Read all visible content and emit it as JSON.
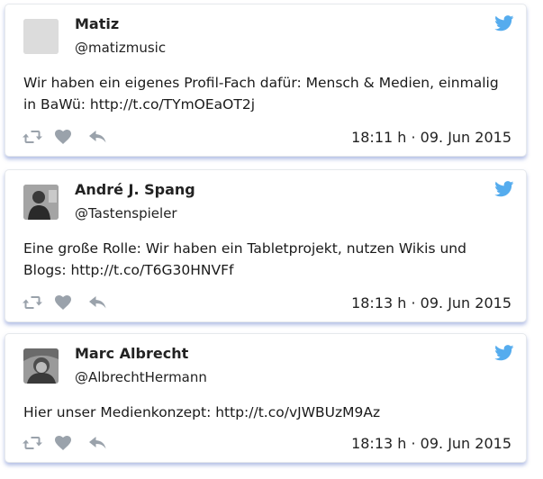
{
  "colors": {
    "twitter_blue": "#55acee",
    "icon_gray": "#9aa2ab",
    "text": "#1a1a1a"
  },
  "tweets": [
    {
      "name": "Matiz",
      "handle": "@matizmusic",
      "avatar": "placeholder-avatar",
      "text": "Wir haben ein eigenes Profil-Fach dafür: Mensch & Medien, einmalig in BaWü: http://t.co/TYmOEaOT2j",
      "timestamp": "18:11 h · 09. Jun 2015"
    },
    {
      "name": "André J. Spang",
      "handle": "@Tastenspieler",
      "avatar": "profile-photo-avatar",
      "text": "Eine große Rolle: Wir haben ein Tabletprojekt, nutzen Wikis und Blogs: http://t.co/T6G30HNVFf",
      "timestamp": "18:13 h · 09. Jun 2015"
    },
    {
      "name": "Marc Albrecht",
      "handle": "@AlbrechtHermann",
      "avatar": "profile-photo-avatar",
      "text": "Hier unser Medienkonzept: http://t.co/vJWBUzM9Az",
      "timestamp": "18:13 h · 09. Jun 2015"
    }
  ],
  "icons": {
    "brand": "twitter-bird-icon",
    "retweet": "retweet-icon",
    "like": "heart-icon",
    "reply": "reply-icon"
  }
}
